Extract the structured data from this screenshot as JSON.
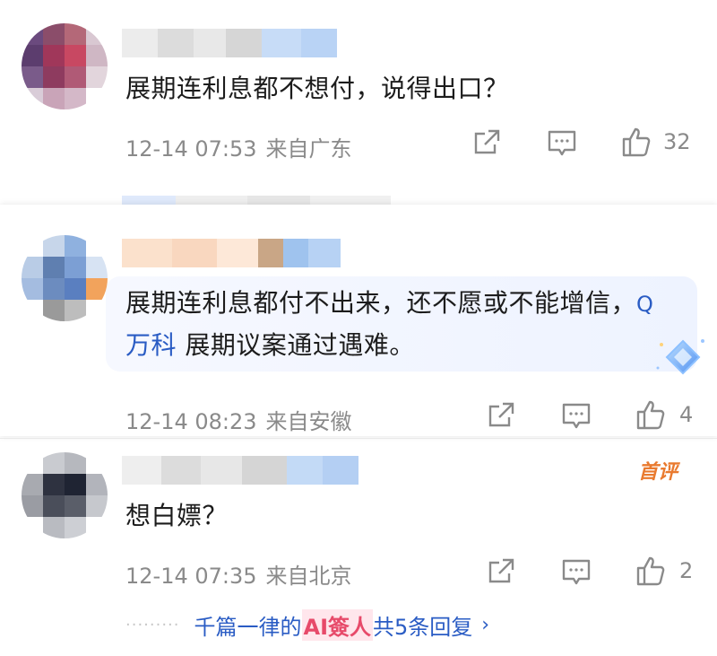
{
  "comments": [
    {
      "text": "展期连利息都不想付，说得出口？",
      "time": "12-14 07:53",
      "location": "来自广东",
      "likes": "32"
    },
    {
      "text_before": "展期连利息都付不出来，还不愿或不能增信，",
      "topic_icon": "Q",
      "topic": "万科",
      "text_after": " 展期议案通过遇难。",
      "time": "12-14 08:23",
      "location": "来自安徽",
      "likes": "4"
    },
    {
      "badge": "首评",
      "text": "想白嫖？",
      "time": "12-14 07:35",
      "location": "来自北京",
      "likes": "2"
    }
  ],
  "replies": {
    "dots": "·········",
    "prefix": "千篇一律的",
    "stamp": "AI簽人",
    "suffix": "共5条回复",
    "chevron": "›"
  },
  "icons": {
    "share": "share-icon",
    "comment": "comment-icon",
    "like": "thumb-up-icon"
  },
  "colors": {
    "link": "#2a5cc4",
    "meta": "#8a8a8a",
    "badge": "#e97a2f"
  }
}
